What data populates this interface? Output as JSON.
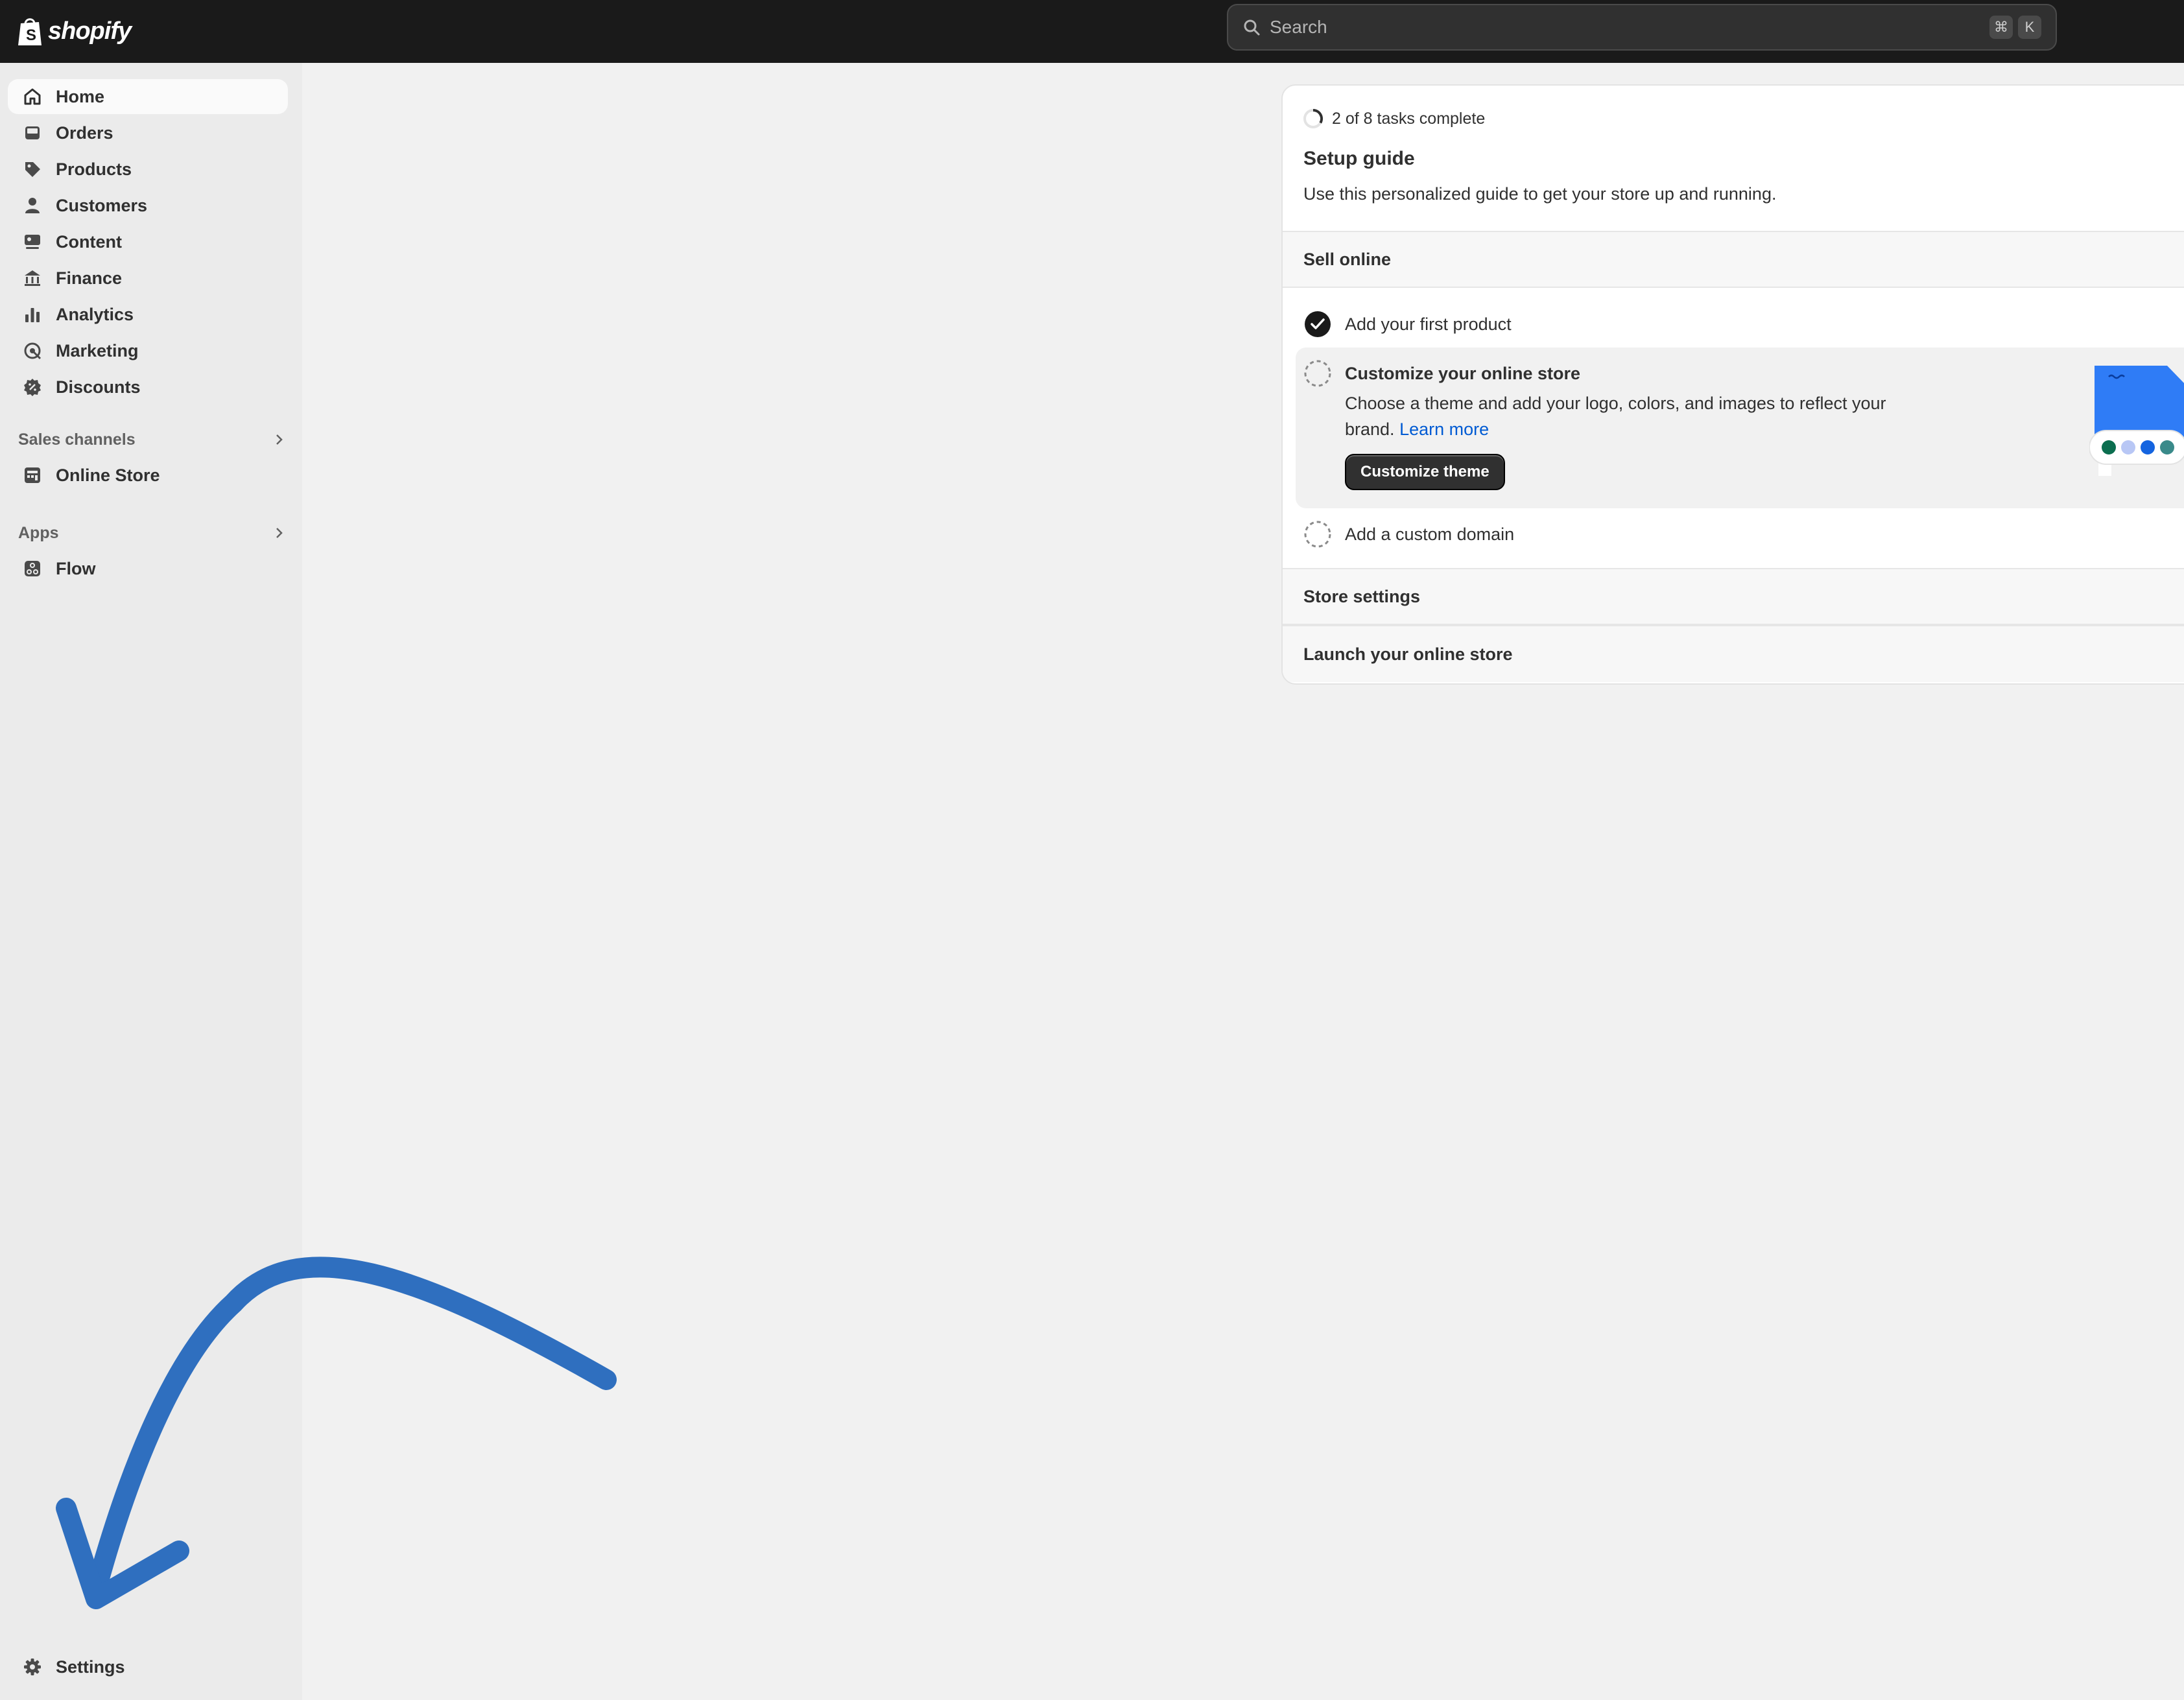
{
  "topbar": {
    "logo_text": "shopify",
    "search_placeholder": "Search",
    "shortcut_keys": [
      "⌘",
      "K"
    ]
  },
  "sidebar": {
    "items": [
      {
        "label": "Home",
        "icon": "home-icon",
        "active": true
      },
      {
        "label": "Orders",
        "icon": "inbox-icon"
      },
      {
        "label": "Products",
        "icon": "tag-icon"
      },
      {
        "label": "Customers",
        "icon": "person-icon"
      },
      {
        "label": "Content",
        "icon": "content-icon"
      },
      {
        "label": "Finance",
        "icon": "bank-icon"
      },
      {
        "label": "Analytics",
        "icon": "bar-chart-icon"
      },
      {
        "label": "Marketing",
        "icon": "target-icon"
      },
      {
        "label": "Discounts",
        "icon": "discount-icon"
      }
    ],
    "sales_channels_label": "Sales channels",
    "sales_channels": [
      {
        "label": "Online Store",
        "icon": "store-icon"
      }
    ],
    "apps_label": "Apps",
    "apps": [
      {
        "label": "Flow",
        "icon": "flow-icon"
      }
    ],
    "settings_label": "Settings"
  },
  "setup_guide": {
    "progress_text": "2 of 8 tasks complete",
    "title": "Setup guide",
    "subtitle": "Use this personalized guide to get your store up and running.",
    "sections": {
      "sell_online": "Sell online",
      "store_settings": "Store settings",
      "launch": "Launch your online store"
    },
    "tasks": {
      "first_product": "Add your first product",
      "customize_title": "Customize your online store",
      "customize_desc": "Choose a theme and add your logo, colors, and images to reflect your brand.",
      "learn_more": "Learn more",
      "customize_button": "Customize theme",
      "custom_domain": "Add a custom domain"
    }
  },
  "colors": {
    "topbar": "#1a1a1a",
    "accent_link": "#005bd3",
    "annotation_arrow": "#2f6fbf"
  }
}
